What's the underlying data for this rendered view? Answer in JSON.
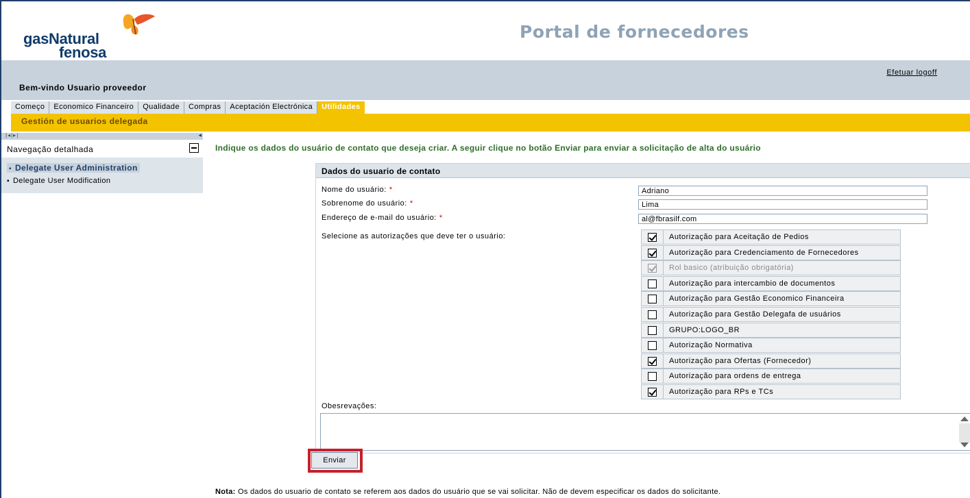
{
  "brand": {
    "logo_line1": "gasNatural",
    "logo_line2": "fenosa",
    "portal_title": "Portal de fornecedores"
  },
  "welcome": {
    "logoff": "Efetuar logoff",
    "greeting": "Bem-vindo  Usuario proveedor"
  },
  "tabs": [
    {
      "label": "Começo"
    },
    {
      "label": "Economico Financeiro"
    },
    {
      "label": "Qualidade"
    },
    {
      "label": "Compras"
    },
    {
      "label": "Aceptación Electrónica"
    },
    {
      "label": "Utilidades"
    }
  ],
  "subnav": {
    "label": "Gestión de usuarios delegada"
  },
  "left_nav": {
    "title": "Navegação detalhada",
    "items": [
      {
        "label": "Delegate User Administration"
      },
      {
        "label": "Delegate User Modification"
      }
    ]
  },
  "instruction": "Indique os dados do usuário de contato que deseja criar. A seguir clique no botão Enviar para enviar a solicitação de alta do usuário",
  "form": {
    "title": "Dados do usuario de contato",
    "first_name_label": "Nome do usuário:",
    "first_name_value": "Adriano",
    "last_name_label": "Sobrenome do usuário:",
    "last_name_value": "Lima",
    "email_label": "Endereço de e-mail do usuário:",
    "email_value": "al@fbrasilf.com",
    "required_mark": "*",
    "permissions_label": "Selecione as autorizações que deve ter o usuário:",
    "permissions": [
      {
        "label": "Autorização para Aceitação de Pedios",
        "checked": true,
        "disabled": false
      },
      {
        "label": "Autorização para Credenciamento de Fornecedores",
        "checked": true,
        "disabled": false
      },
      {
        "label": "Rol basico (atribuição obrigatória)",
        "checked": true,
        "disabled": true
      },
      {
        "label": "Autorização para intercambio de documentos",
        "checked": false,
        "disabled": false
      },
      {
        "label": "Autorização para Gestão Economico Financeira",
        "checked": false,
        "disabled": false
      },
      {
        "label": "Autorização para Gestão Delegafa de usuários",
        "checked": false,
        "disabled": false
      },
      {
        "label": "GRUPO:LOGO_BR",
        "checked": false,
        "disabled": false
      },
      {
        "label": "Autorização Normativa",
        "checked": false,
        "disabled": false
      },
      {
        "label": "Autorização para Ofertas (Fornecedor)",
        "checked": true,
        "disabled": false
      },
      {
        "label": "Autorização para ordens de entrega",
        "checked": false,
        "disabled": false
      },
      {
        "label": "Autorização para RPs e TCs",
        "checked": true,
        "disabled": false
      }
    ],
    "observations_label": "Obesrevações:",
    "observations_value": "",
    "submit_label": "Enviar"
  },
  "note": {
    "bold": "Nota:",
    "text": " Os dados do usuario de contato se referem aos dados do usuário que se vai solicitar. Não de devem especificar os dados do solicitante."
  },
  "colors": {
    "brand_blue": "#0f3b6b",
    "accent_yellow": "#f4c300",
    "highlight_red": "#c61f2e",
    "instruction_green": "#2f6e2a"
  }
}
